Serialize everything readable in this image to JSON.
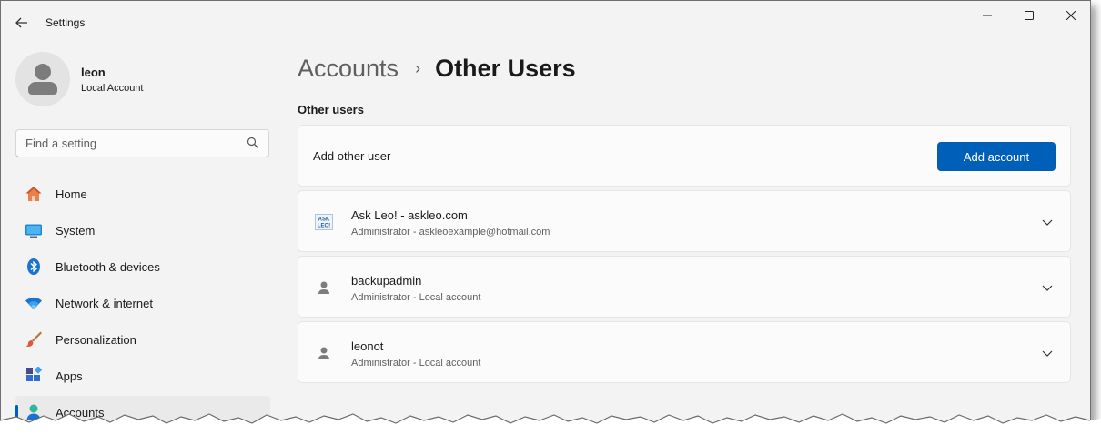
{
  "window": {
    "app_title": "Settings",
    "back_icon": "back-arrow-icon",
    "controls": [
      "minimize-icon",
      "maximize-icon",
      "close-icon"
    ]
  },
  "profile": {
    "name": "leon",
    "account_type": "Local Account"
  },
  "search": {
    "placeholder": "Find a setting"
  },
  "nav": {
    "items": [
      {
        "label": "Home",
        "icon": "home-icon"
      },
      {
        "label": "System",
        "icon": "system-icon"
      },
      {
        "label": "Bluetooth & devices",
        "icon": "bluetooth-icon"
      },
      {
        "label": "Network & internet",
        "icon": "wifi-icon"
      },
      {
        "label": "Personalization",
        "icon": "brush-icon"
      },
      {
        "label": "Apps",
        "icon": "apps-icon"
      },
      {
        "label": "Accounts",
        "icon": "accounts-icon",
        "active": true
      }
    ]
  },
  "breadcrumb": {
    "parent": "Accounts",
    "separator": "›",
    "current": "Other Users"
  },
  "section": {
    "title": "Other users"
  },
  "add_user": {
    "label": "Add other user",
    "button": "Add account"
  },
  "users": [
    {
      "name": "Ask Leo! - askleo.com",
      "detail": "Administrator - askleoexample@hotmail.com",
      "icon": "askleo-logo-icon",
      "logo_text": [
        "ASK",
        "LEO!"
      ]
    },
    {
      "name": "backupadmin",
      "detail": "Administrator - Local account",
      "icon": "user-icon"
    },
    {
      "name": "leonot",
      "detail": "Administrator - Local account",
      "icon": "user-icon"
    }
  ],
  "colors": {
    "accent": "#005fb8",
    "window_bg": "#f3f3f3",
    "card_bg": "#fbfbfb"
  }
}
